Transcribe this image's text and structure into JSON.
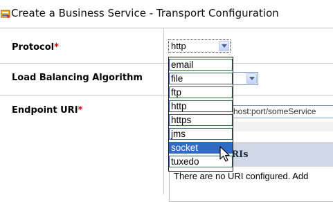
{
  "title": "Create a Business Service - Transport Configuration",
  "form": {
    "protocol": {
      "label": "Protocol",
      "required_mark": "*",
      "value": "http"
    },
    "load_balancing": {
      "label": "Load Balancing Algorithm",
      "value": ""
    },
    "endpoint_uri": {
      "label": "Endpoint URI",
      "required_mark": "*",
      "value": "://host:port/someService",
      "table_header": "URIs",
      "empty_message": "There are no URI configured. Add"
    }
  },
  "protocol_dropdown": {
    "options": [
      "email",
      "file",
      "ftp",
      "http",
      "https",
      "jms",
      "socket",
      "tuxedo"
    ],
    "highlighted": "socket"
  },
  "colors": {
    "required": "#cc0000",
    "highlight": "#316ac5",
    "header_bg": "#cfd9e6",
    "field_border": "#7f9db9"
  },
  "icons": [
    "service-config-icon",
    "chevron-down-icon",
    "mouse-pointer-icon"
  ]
}
